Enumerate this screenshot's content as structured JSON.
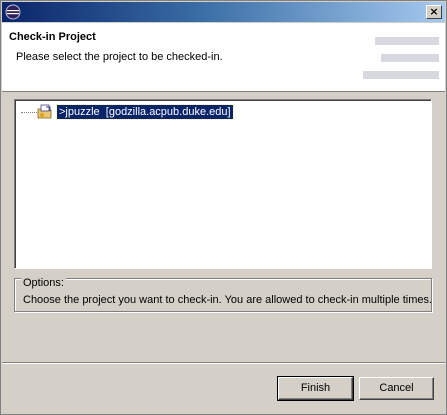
{
  "window": {
    "title": "",
    "close_glyph": "×",
    "app_icon": "eclipse-icon"
  },
  "header": {
    "title": "Check-in Project",
    "message": "Please select the project to be checked-in."
  },
  "tree": {
    "items": [
      {
        "label": ">jpuzzle  [godzilla.acpub.duke.edu]",
        "icon": "project-folder-icon",
        "selected": true
      }
    ]
  },
  "options": {
    "legend": "Options:",
    "text": "Choose the project you want to check-in. You are allowed to check-in multiple times."
  },
  "buttons": {
    "finish": "Finish",
    "cancel": "Cancel"
  },
  "colors": {
    "selection": "#0a246a",
    "dialog_bg": "#d4d0c8",
    "title_gradient_start": "#0a246a"
  }
}
